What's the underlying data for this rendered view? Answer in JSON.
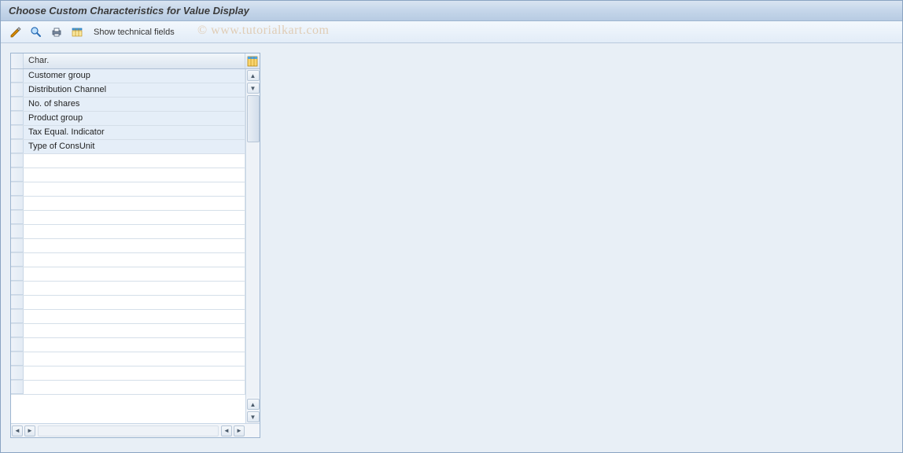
{
  "title": "Choose Custom Characteristics for Value Display",
  "toolbar": {
    "show_technical": "Show technical fields"
  },
  "watermark": "© www.tutorialkart.com",
  "grid": {
    "header": "Char.",
    "rows": [
      "Customer group",
      "Distribution Channel",
      "No. of shares",
      "Product group",
      "Tax Equal. Indicator",
      "Type of ConsUnit"
    ],
    "empty_rows": 17
  }
}
